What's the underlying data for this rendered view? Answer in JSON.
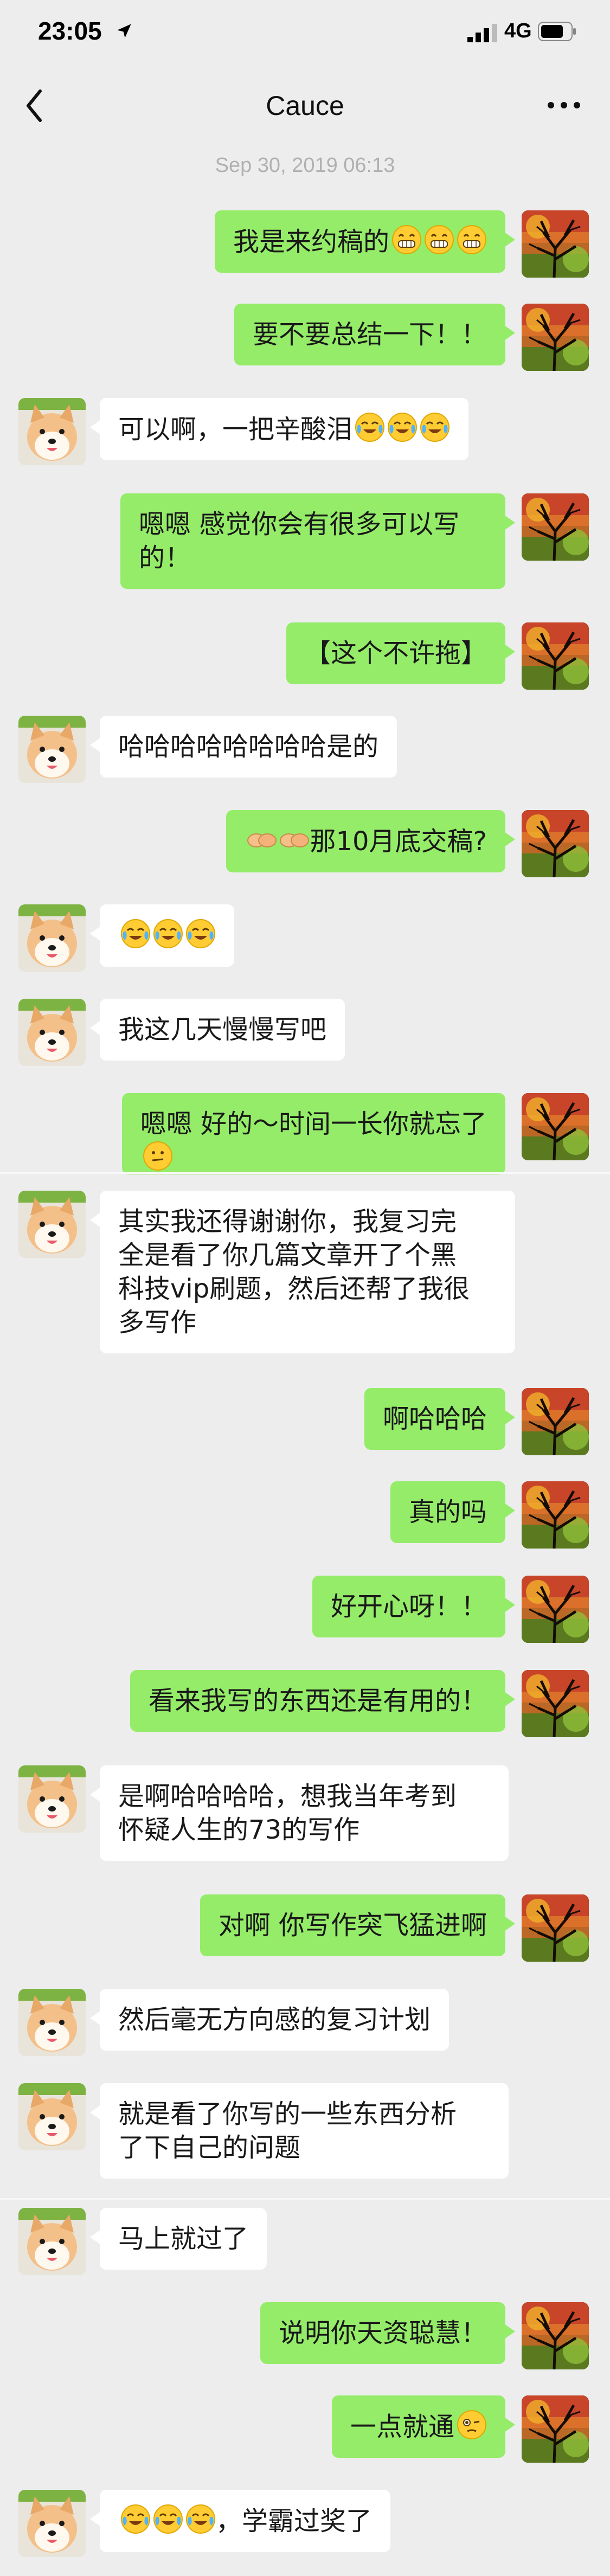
{
  "status": {
    "time": "23:05",
    "network": "4G"
  },
  "nav": {
    "title": "Cauce"
  },
  "timestamp": "Sep 30, 2019 06:13",
  "messages": [
    {
      "from": "me",
      "text": "我是来约稿的"
    },
    {
      "from": "me",
      "text": "要不要总结一下！！"
    },
    {
      "from": "other",
      "text": "可以啊，一把辛酸泪"
    },
    {
      "from": "me",
      "text": "嗯嗯 感觉你会有很多可以写\n的！"
    },
    {
      "from": "me",
      "text": "【这个不许拖】"
    },
    {
      "from": "other",
      "text": "哈哈哈哈哈哈哈哈是的"
    },
    {
      "from": "me",
      "text": "那10月底交稿?"
    },
    {
      "from": "other",
      "text": ""
    },
    {
      "from": "other",
      "text": "我这几天慢慢写吧"
    },
    {
      "from": "me",
      "text": "嗯嗯 好的～时间一长你就忘了"
    },
    {
      "from": "other",
      "text": "其实我还得谢谢你，我复习完\n全是看了你几篇文章开了个黑\n科技vip刷题，然后还帮了我很\n多写作"
    },
    {
      "from": "me",
      "text": "啊哈哈哈"
    },
    {
      "from": "me",
      "text": "真的吗"
    },
    {
      "from": "me",
      "text": "好开心呀！！"
    },
    {
      "from": "me",
      "text": "看来我写的东西还是有用的！"
    },
    {
      "from": "other",
      "text": "是啊哈哈哈哈，想我当年考到\n怀疑人生的73的写作"
    },
    {
      "from": "me",
      "text": "对啊 你写作突飞猛进啊"
    },
    {
      "from": "other",
      "text": "然后毫无方向感的复习计划"
    },
    {
      "from": "other",
      "text": "就是看了你写的一些东西分析\n了下自己的问题"
    },
    {
      "from": "other",
      "text": "马上就过了"
    },
    {
      "from": "me",
      "text": "说明你天资聪慧！"
    },
    {
      "from": "me",
      "text": "一点就通"
    },
    {
      "from": "other",
      "text": "，学霸过奖了"
    }
  ]
}
